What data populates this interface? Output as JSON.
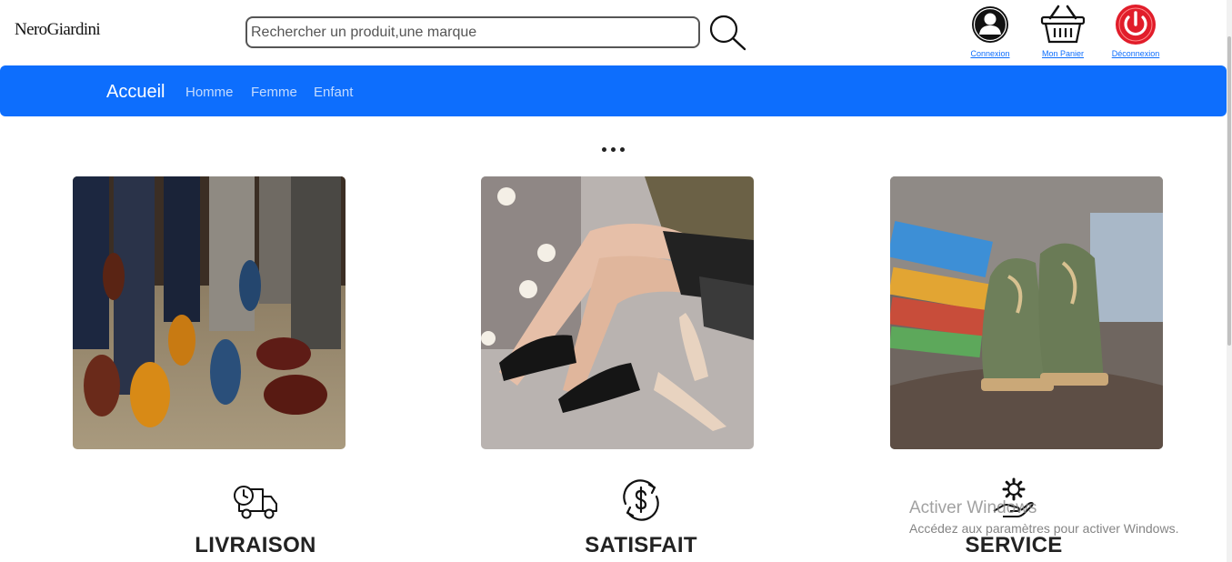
{
  "header": {
    "logo": "NeroGiardini",
    "search": {
      "placeholder": "Rechercher un produit,une marque",
      "value": ""
    },
    "actions": [
      {
        "label": "Connexion",
        "icon": "user-icon"
      },
      {
        "label": "Mon Panier",
        "icon": "basket-icon"
      },
      {
        "label": "Déconnexion",
        "icon": "power-icon"
      }
    ]
  },
  "navbar": {
    "brand": "Accueil",
    "links": [
      "Homme",
      "Femme",
      "Enfant"
    ],
    "color": "#0d6efd"
  },
  "gallery": {
    "carousel_indicator": "more-dots-icon",
    "cards": [
      {
        "alt": "Chaussures homme"
      },
      {
        "alt": "Chaussures femme"
      },
      {
        "alt": "Chaussures enfant"
      }
    ]
  },
  "features": [
    {
      "title": "LIVRAISON",
      "icon": "delivery-truck-icon"
    },
    {
      "title": "SATISFAIT",
      "icon": "money-back-icon"
    },
    {
      "title": "SERVICE",
      "icon": "service-gear-hand-icon"
    }
  ],
  "watermark": {
    "title": "Activer Windows",
    "subtitle": "Accédez aux paramètres pour activer Windows."
  }
}
